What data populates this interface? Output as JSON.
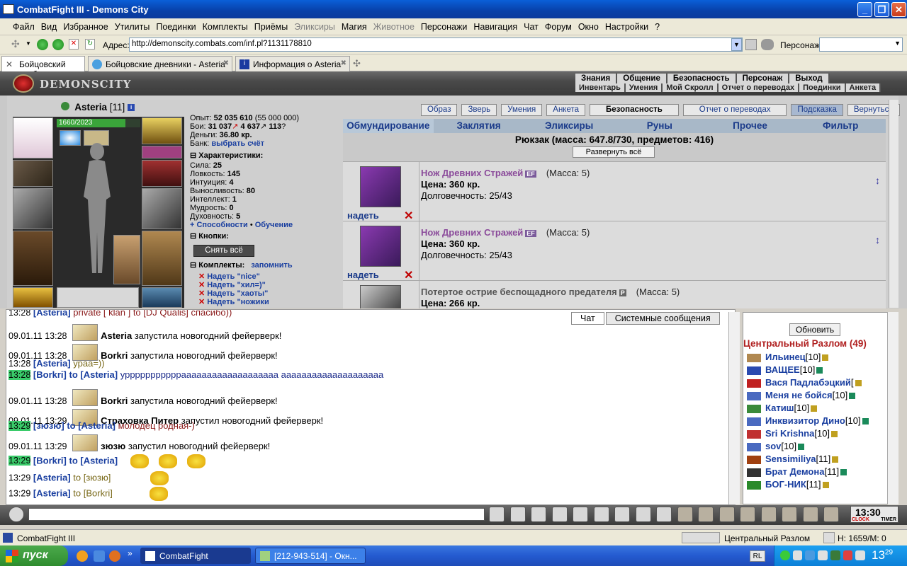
{
  "window": {
    "title": "CombatFight III - Demons City"
  },
  "menu": [
    "Файл",
    "Вид",
    "Избранное",
    "Утилиты",
    "Поединки",
    "Комплекты",
    "Приёмы",
    "Эликсиры",
    "Магия",
    "Животное",
    "Персонажи",
    "Навигация",
    "Чат",
    "Форум",
    "Окно",
    "Настройки",
    "?"
  ],
  "menu_disabled": [
    7,
    9
  ],
  "address": {
    "label": "Адрес:",
    "url": "http://demonscity.combats.com/inf.pl?1131178810",
    "persona_label": "Персонаж:"
  },
  "tabs": [
    {
      "label": "Бойцовский клуб",
      "active": true
    },
    {
      "label": "Бойцовские дневники - Asteria",
      "active": false
    },
    {
      "label": "Информация о Asteria",
      "active": false
    }
  ],
  "game": {
    "logo_text": "DEMONSCITY",
    "top_menu_1": [
      "Знания",
      "Общение",
      "Безопасность",
      "Персонаж",
      "Выход"
    ],
    "top_menu_2": [
      "Инвентарь",
      "Умения",
      "Мой Скролл",
      "Отчет о переводах",
      "Поединки",
      "Анкета"
    ],
    "character": {
      "name": "Asteria",
      "level": "[11]",
      "hp_text": "1660/2023",
      "hp_fraction": 0.82
    },
    "stats": {
      "exp_label": "Опыт:",
      "exp": "52 035 610",
      "exp_next": "(55 000 000)",
      "fights_label": "Бои:",
      "fights_won": "31 037",
      "fights_lost": "4 637",
      "fights_draw": "113",
      "money_label": "Деньги:",
      "money": "36.80 кр.",
      "bank_label": "Банк:",
      "bank_link": "выбрать счёт"
    },
    "characteristics": {
      "title": "Характеристики:",
      "items": [
        {
          "label": "Сила:",
          "value": "25"
        },
        {
          "label": "Ловкость:",
          "value": "145"
        },
        {
          "label": "Интуиция:",
          "value": "4"
        },
        {
          "label": "Выносливость:",
          "value": "80"
        },
        {
          "label": "Интеллект:",
          "value": "1"
        },
        {
          "label": "Мудрость:",
          "value": "0"
        },
        {
          "label": "Духовность:",
          "value": "5"
        }
      ],
      "abilities_link": "+ Способности",
      "training_link": "Обучение"
    },
    "buttons_section": {
      "title": "Кнопки:",
      "unequip_all": "Снять всё"
    },
    "sets_section": {
      "title": "Комплекты:",
      "remember": "запомнить",
      "sets": [
        "Надеть \"nice\"",
        "Надеть \"хил=)\"",
        "Надеть \"хаоты\"",
        "Надеть \"ножики"
      ]
    },
    "right_buttons": [
      "Образ",
      "Зверь",
      "Умения",
      "Анкета",
      "Безопасность",
      "Отчет о переводах",
      "Подсказка",
      "Вернуться"
    ],
    "inventory_tabs": [
      "Обмундирование",
      "Заклятия",
      "Эликсиры",
      "Руны",
      "Прочее",
      "Фильтр"
    ],
    "backpack": {
      "text": "Рюкзак (масса: 647.8/730, предметов: 416)",
      "expand_button": "Развернуть всё"
    },
    "items": [
      {
        "name": "Нож Древних Стражей",
        "badge": "EF",
        "mass": "(Масса: 5)",
        "price": "Цена: 360 кр.",
        "durability": "Долговечность: 25/43",
        "wear": "надеть"
      },
      {
        "name": "Нож Древних Стражей",
        "badge": "EF",
        "mass": "(Масса: 5)",
        "price": "Цена: 360 кр.",
        "durability": "Долговечность: 25/43",
        "wear": "надеть"
      },
      {
        "name": "Потертое острие беспощадного предателя",
        "badge": "P",
        "mass": "(Масса: 5)",
        "price": "Цена: 266 кр.",
        "durability": "",
        "wear": ""
      }
    ]
  },
  "chat": {
    "tabs": [
      "Чат",
      "Системные сообщения"
    ],
    "lines": [
      {
        "ts": "13:28",
        "green": false,
        "nick": "[Asteria]",
        "msg": "private [ klan ] to [DJ Qualis] спасибо))",
        "kind": "partial"
      },
      {
        "ts": "09.01.11 13:28",
        "firework": true,
        "nick": "Asteria",
        "msg": "запустила новогодний фейерверк!"
      },
      {
        "ts": "09.01.11 13:28",
        "firework": true,
        "nick": "Borkri",
        "msg": "запустила новогодний фейерверк!"
      },
      {
        "ts": "13:28",
        "green": false,
        "nick": "[Asteria]",
        "msg": "ураа=))",
        "kind": "plain"
      },
      {
        "ts": "13:28",
        "green": true,
        "nick": "[Borkri]",
        "to": "to [Asteria]",
        "msg": "урррррррррррааааааааааааааааааа аааааааааааааааааааа",
        "kind": "to"
      },
      {
        "ts": "09.01.11 13:28",
        "firework": true,
        "nick": "Borkri",
        "msg": "запустила новогодний фейерверк!"
      },
      {
        "ts": "09.01.11 13:29",
        "firework": true,
        "nick": "Страховка Питер",
        "msg": "запустил новогодний фейерверк!"
      },
      {
        "ts": "13:29",
        "green": true,
        "nick": "[зюзю]",
        "to": "to [Asteria]",
        "msg": "молодец родная-)",
        "kind": "to-red"
      },
      {
        "ts": "09.01.11 13:29",
        "firework": true,
        "nick": "зюзю",
        "msg": "запустил новогодний фейерверк!"
      },
      {
        "ts": "13:29",
        "green": true,
        "nick": "[Borkri]",
        "to": "to [Asteria]",
        "msg": "",
        "kind": "birds3"
      },
      {
        "ts": "13:29",
        "green": false,
        "nick": "[Asteria]",
        "to": "to [зюзю]",
        "msg": "",
        "kind": "bird1"
      },
      {
        "ts": "13:29",
        "green": false,
        "nick": "[Asteria]",
        "to": "to [Borkri]",
        "msg": "",
        "kind": "bird1"
      }
    ]
  },
  "online": {
    "refresh": "Обновить",
    "room": "Центральный Разлом (49)",
    "users": [
      {
        "name": "Ильинец",
        "level": "[10]"
      },
      {
        "name": "ВАЩЕЕ",
        "level": "[10]"
      },
      {
        "name": "Вася Падлабэцкий",
        "level": "["
      },
      {
        "name": "Меня не бойся",
        "level": "[10]"
      },
      {
        "name": "Катиш",
        "level": "[10]"
      },
      {
        "name": "Инквизитор Дино",
        "level": "[10]"
      },
      {
        "name": "Sri Krishna",
        "level": "[10]"
      },
      {
        "name": "sov",
        "level": "[10]"
      },
      {
        "name": "Sensimiliya",
        "level": "[11]"
      },
      {
        "name": "Брат Демона",
        "level": "[11]"
      },
      {
        "name": "БОГ-НИК",
        "level": "[11]"
      }
    ]
  },
  "clock": {
    "time": "13:30",
    "clock_label": "CLOCK",
    "timer_label": "TIMER"
  },
  "status": {
    "left": "CombatFight III",
    "room": "Центральный Разлом",
    "hm": "H: 1659/M: 0"
  },
  "taskbar": {
    "start": "пуск",
    "tasks": [
      "CombatFight",
      "[212-943-514] - Окн..."
    ],
    "lang": "RL",
    "time": "13",
    "time_sup": "29"
  },
  "colors": {
    "title_blue": "#0a5fd8",
    "room_red": "#b02020",
    "nick_blue": "#1a3fa0",
    "ts_green": "#3acb6a",
    "item_purple": "#8a4a9a"
  }
}
